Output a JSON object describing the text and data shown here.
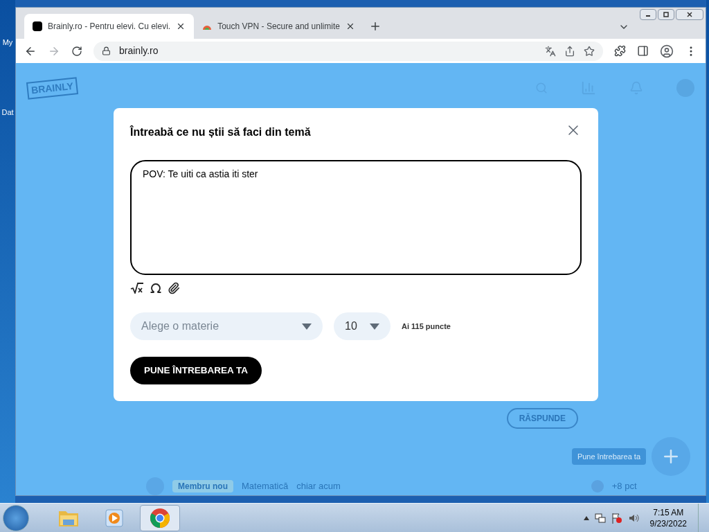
{
  "desktop": {
    "icons": [
      {
        "label": "My"
      },
      {
        "label": "Dat"
      }
    ]
  },
  "browser": {
    "tabs": [
      {
        "title": "Brainly.ro - Pentru elevi. Cu elevi.",
        "selected": true
      },
      {
        "title": "Touch VPN - Secure and unlimite",
        "selected": false
      }
    ],
    "address": "brainly.ro"
  },
  "page": {
    "logo": "BRAINLY",
    "answer_button": "RĂSPUNDE",
    "ask_button": "Pune întrebarea ta",
    "badge": "Membru nou",
    "subject": "Matematică",
    "time": "chiar acum",
    "points": "+8 pct"
  },
  "dialog": {
    "title": "Întreabă ce nu știi să faci din temă",
    "question": "POV: Te uiti ca astia iti ster",
    "subject_placeholder": "Alege o materie",
    "points_value": "10",
    "points_note": "Ai 115 puncte",
    "submit": "PUNE ÎNTREBAREA TA"
  },
  "taskbar": {
    "time": "7:15 AM",
    "date": "9/23/2022",
    "apps": [
      {
        "kind": "folder",
        "selected": false
      },
      {
        "kind": "media",
        "selected": false
      },
      {
        "kind": "chrome",
        "selected": true
      }
    ]
  }
}
